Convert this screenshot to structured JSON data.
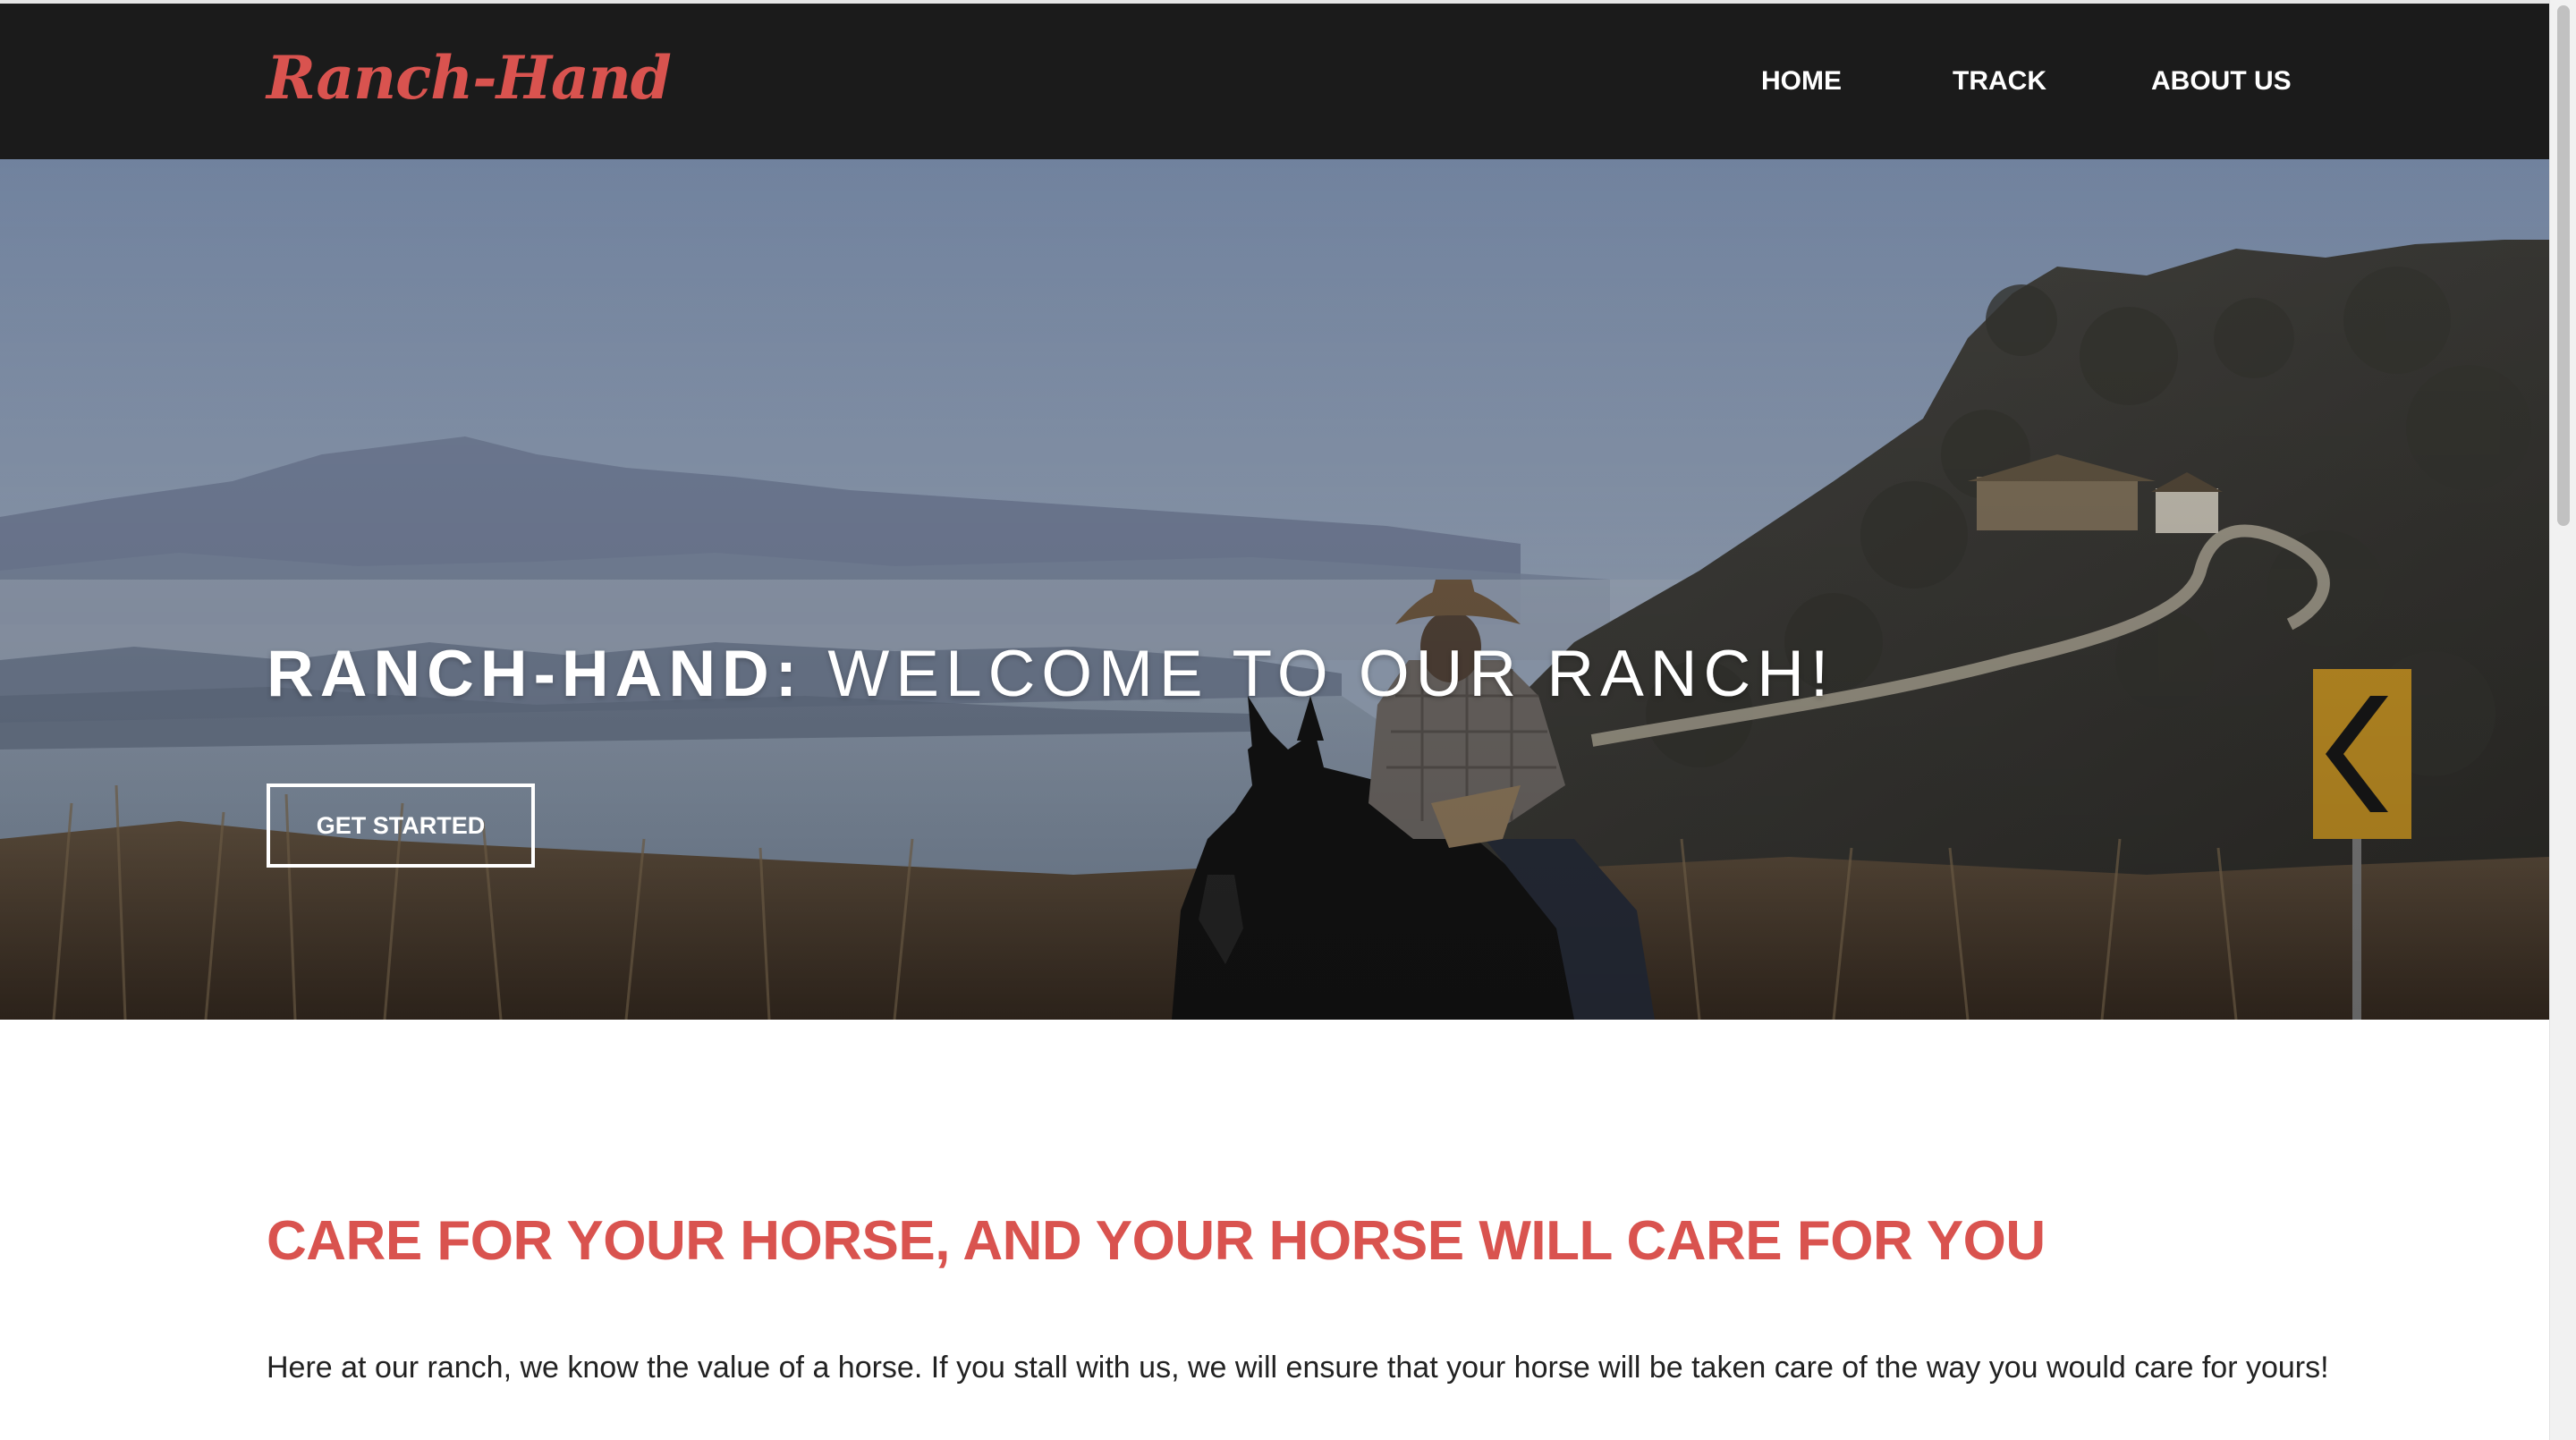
{
  "navbar": {
    "brand": "Ranch-Hand",
    "links": [
      "HOME",
      "TRACK",
      "ABOUT US"
    ]
  },
  "hero": {
    "title_strong": "RANCH-HAND:",
    "title_light": "WELCOME TO OUR RANCH!",
    "cta_label": "GET STARTED"
  },
  "content": {
    "heading": "CARE FOR YOUR HORSE, AND YOUR HORSE WILL CARE FOR YOU",
    "body": "Here at our ranch, we know the value of a horse. If you stall with us, we will ensure that your horse will be taken care of the way you would care for yours!"
  },
  "colors": {
    "accent": "#d9534f",
    "navbar_bg": "#1b1b1b",
    "text_dark": "#222222"
  },
  "icons": [
    "scrollbar"
  ]
}
